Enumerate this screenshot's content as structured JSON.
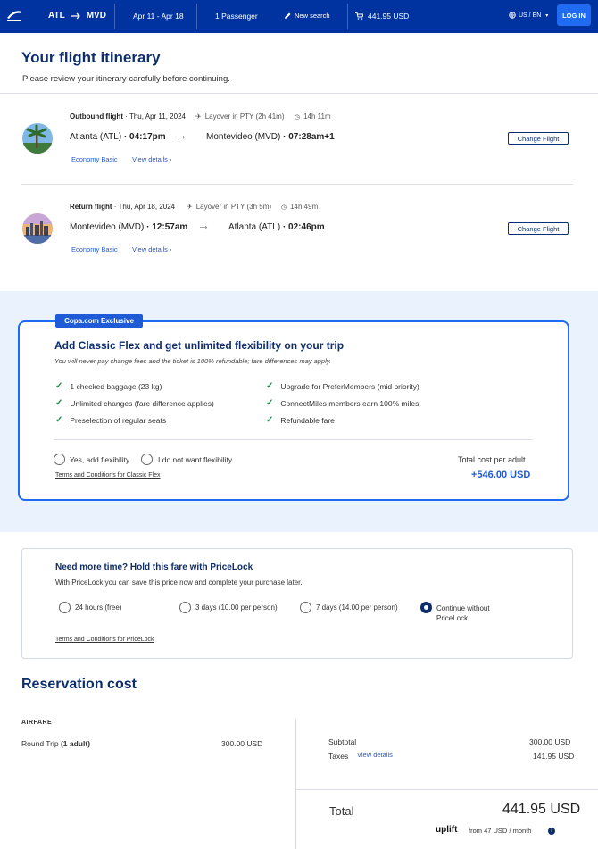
{
  "header": {
    "origin": "ATL",
    "destination": "MVD",
    "dates": "Apr 11 - Apr 18",
    "passengers": "1 Passenger",
    "new_search": "New search",
    "total": "441.95 USD",
    "locale": "US / EN",
    "login": "LOG IN"
  },
  "itinerary": {
    "title": "Your flight itinerary",
    "subtitle": "Please review your itinerary carefully before continuing."
  },
  "outbound": {
    "label": "Outbound flight",
    "date": "· Thu, Apr 11, 2024",
    "layover": "Layover in PTY (2h 41m)",
    "duration": "14h 11m",
    "from_city": "Atlanta (ATL)",
    "from_time": "· 04:17pm",
    "to_city": "Montevideo (MVD)",
    "to_time": "· 07:28am+1",
    "fare": "Economy Basic",
    "details": "View details",
    "change": "Change Flight"
  },
  "return": {
    "label": "Return flight",
    "date": "· Thu, Apr 18, 2024",
    "layover": "Layover in PTY (3h 5m)",
    "duration": "14h 49m",
    "from_city": "Montevideo (MVD)",
    "from_time": "· 12:57am",
    "to_city": "Atlanta (ATL)",
    "to_time": "· 02:46pm",
    "fare": "Economy Basic",
    "details": "View details",
    "change": "Change Flight"
  },
  "flex": {
    "badge": "Copa.com Exclusive",
    "title": "Add Classic Flex and get unlimited flexibility on your trip",
    "subtitle": "You will never pay change fees and the ticket is 100% refundable; fare differences may apply.",
    "benefits_left": [
      "1 checked baggage (23 kg)",
      "Unlimited changes (fare difference applies)",
      "Preselection of regular seats"
    ],
    "benefits_right": [
      "Upgrade for PreferMembers (mid priority)",
      "ConnectMiles members earn 100% miles",
      "Refundable fare"
    ],
    "option_yes": "Yes, add flexibility",
    "option_no": "I do not want flexibility",
    "terms": "Terms and Conditions for Classic Flex",
    "cost_label": "Total cost per adult",
    "cost": "+546.00 USD"
  },
  "pricelock": {
    "title": "Need more time? Hold this fare with PriceLock",
    "subtitle": "With PriceLock you can save this price now and complete your purchase later.",
    "options": [
      "24 hours (free)",
      "3 days (10.00 per person)",
      "7 days (14.00 per person)",
      "Continue without PriceLock"
    ],
    "selected_index": 3,
    "terms": "Terms and Conditions for PriceLock"
  },
  "reservation": {
    "title": "Reservation cost",
    "airfare_label": "AIRFARE",
    "round_trip": "Round Trip",
    "adults": "(1 adult)",
    "round_trip_price": "300.00 USD",
    "subtotal_label": "Subtotal",
    "subtotal": "300.00 USD",
    "taxes_label": "Taxes",
    "taxes_link": "View details",
    "taxes": "141.95 USD",
    "total_label": "Total",
    "total": "441.95 USD",
    "uplift": "uplift",
    "monthly": "from 47 USD",
    "per_month": "/ month"
  },
  "colors": {
    "brand_blue": "#0032a0",
    "accent": "#1f6bf2",
    "navy": "#0d2e6b",
    "check_green": "#1b8a4a"
  }
}
